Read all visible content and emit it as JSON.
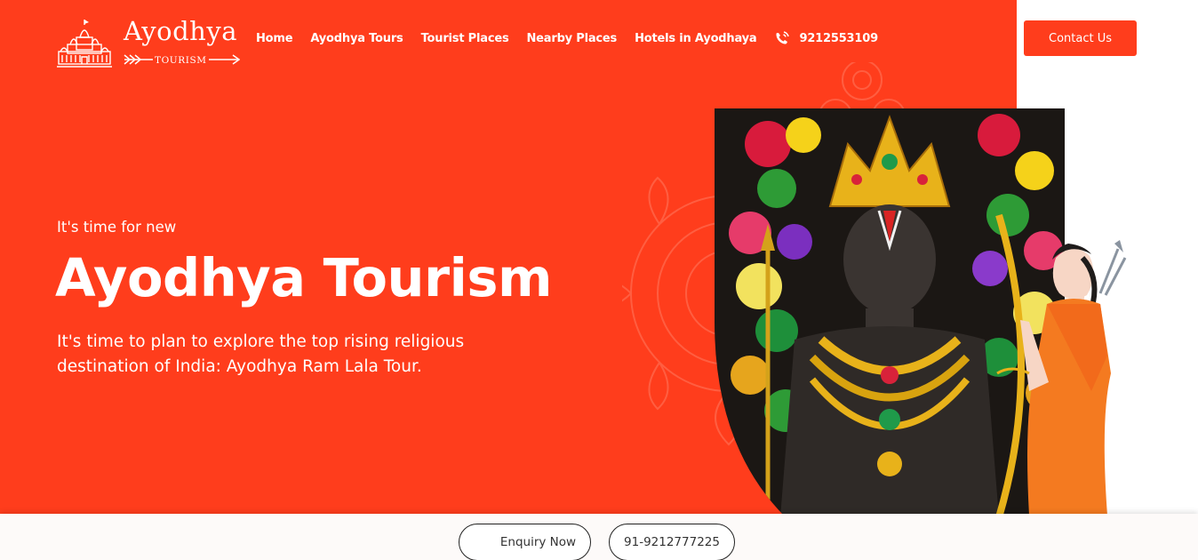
{
  "logo": {
    "title": "Ayodhya",
    "subtitle": "TOURISM"
  },
  "nav": {
    "items": [
      "Home",
      "Ayodhya Tours",
      "Tourist Places",
      "Nearby Places",
      "Hotels in Ayodhaya"
    ],
    "phone": "9212553109",
    "phone_icon": "phone-ring-icon"
  },
  "header": {
    "contact_label": "Contact Us"
  },
  "hero": {
    "eyebrow": "It's time for new",
    "title": "Ayodhya Tourism",
    "description": "It's time to plan to explore the top rising religious destination of India: Ayodhya Ram Lala Tour."
  },
  "bottom_bar": {
    "enquiry_label": "Enquiry Now",
    "phone_label": "91-9212777225"
  },
  "colors": {
    "brand": "#ff3d1c",
    "white": "#ffffff",
    "saffron": "#f26a1b"
  }
}
